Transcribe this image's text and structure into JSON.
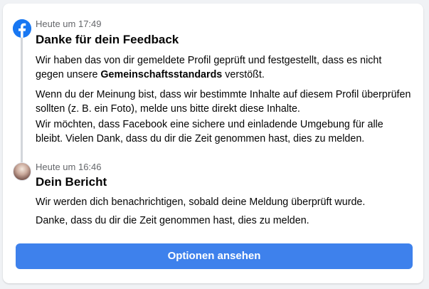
{
  "colors": {
    "brand": "#1877f2",
    "button": "#3e81ec",
    "timestamp": "#65676b",
    "line": "#d3d6db"
  },
  "entries": [
    {
      "icon": "facebook-logo-icon",
      "timestamp": "Heute um 17:49",
      "title": "Danke für dein Feedback",
      "p1_before": "Wir haben das von dir gemeldete Profil geprüft und festgestellt, dass es nicht gegen unsere ",
      "p1_bold": "Gemeinschaftsstandards",
      "p1_after": " verstößt.",
      "p2": "Wenn du der Meinung bist, dass wir bestimmte Inhalte auf diesem Profil überprüfen sollten (z. B. ein Foto), melde uns bitte direkt diese Inhalte.",
      "p3": "Wir möchten, dass Facebook eine sichere und einladende Umgebung für alle bleibt. Vielen Dank, dass du dir die Zeit genommen hast, dies zu melden."
    },
    {
      "icon": "user-avatar",
      "timestamp": "Heute um 16:46",
      "title": "Dein Bericht",
      "p1": "Wir werden dich benachrichtigen, sobald deine Meldung überprüft wurde.",
      "p2": "Danke, dass du dir die Zeit genommen hast, dies zu melden."
    }
  ],
  "button": {
    "label": "Optionen ansehen"
  }
}
